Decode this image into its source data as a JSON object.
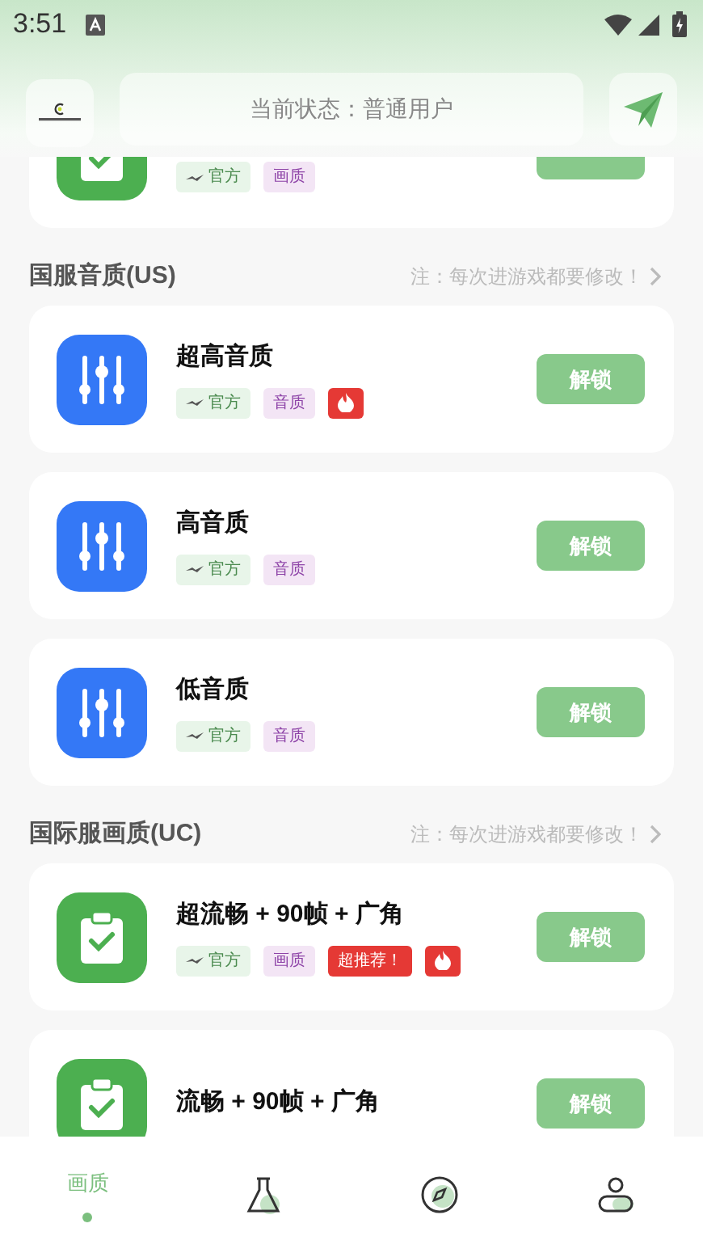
{
  "status_bar": {
    "time": "3:51"
  },
  "header": {
    "status_text": "当前状态：普通用户"
  },
  "sections": [
    {
      "cards": [
        {
          "kind": "clipboard",
          "tags": [
            {
              "kind": "official",
              "text": "官方"
            },
            {
              "kind": "category",
              "text": "画质"
            }
          ]
        }
      ]
    },
    {
      "title": "国服音质(US)",
      "note": "注：每次进游戏都要修改！",
      "cards": [
        {
          "kind": "equalizer",
          "title": "超高音质",
          "tags": [
            {
              "kind": "official",
              "text": "官方"
            },
            {
              "kind": "category",
              "text": "音质"
            },
            {
              "kind": "hot"
            }
          ],
          "button": "解锁"
        },
        {
          "kind": "equalizer",
          "title": "高音质",
          "tags": [
            {
              "kind": "official",
              "text": "官方"
            },
            {
              "kind": "category",
              "text": "音质"
            }
          ],
          "button": "解锁"
        },
        {
          "kind": "equalizer",
          "title": "低音质",
          "tags": [
            {
              "kind": "official",
              "text": "官方"
            },
            {
              "kind": "category",
              "text": "音质"
            }
          ],
          "button": "解锁"
        }
      ]
    },
    {
      "title": "国际服画质(UC)",
      "note": "注：每次进游戏都要修改！",
      "cards": [
        {
          "kind": "clipboard",
          "title": "超流畅 + 90帧 + 广角",
          "tags": [
            {
              "kind": "official",
              "text": "官方"
            },
            {
              "kind": "category",
              "text": "画质"
            },
            {
              "kind": "recommend",
              "text": "超推荐！"
            },
            {
              "kind": "hot"
            }
          ],
          "button": "解锁"
        },
        {
          "kind": "clipboard",
          "title": "流畅 + 90帧 + 广角",
          "button": "解锁"
        }
      ]
    }
  ],
  "tabs": [
    {
      "label": "画质",
      "selected": true
    },
    {
      "kind": "flask",
      "selected": false
    },
    {
      "kind": "compass",
      "selected": false
    },
    {
      "kind": "person",
      "selected": false
    }
  ]
}
